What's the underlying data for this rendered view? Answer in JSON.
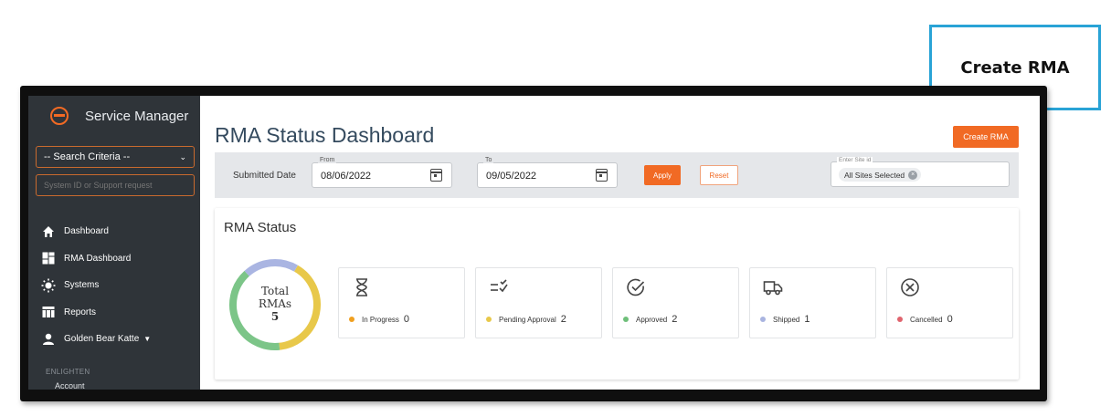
{
  "callout": {
    "text": "Create RMA"
  },
  "sidebar": {
    "brand": "Service Manager",
    "search_criteria": "-- Search Criteria --",
    "search_placeholder": "System ID or Support request",
    "nav": [
      {
        "label": "Dashboard",
        "icon": "home-icon"
      },
      {
        "label": "RMA Dashboard",
        "icon": "grid-icon"
      },
      {
        "label": "Systems",
        "icon": "sun-icon"
      },
      {
        "label": "Reports",
        "icon": "table-icon"
      },
      {
        "label": "Golden Bear Katte",
        "icon": "user-icon"
      }
    ],
    "section_label": "ENLIGHTEN",
    "section_item": "Account"
  },
  "header": {
    "title": "RMA Status Dashboard",
    "create_button": "Create RMA"
  },
  "filters": {
    "submitted_label": "Submitted Date",
    "from_label": "From",
    "from_value": "08/06/2022",
    "to_label": "To",
    "to_value": "09/05/2022",
    "apply": "Apply",
    "reset": "Reset",
    "site_label": "Enter Site id",
    "site_chip": "All Sites Selected"
  },
  "status": {
    "title": "RMA Status",
    "total_line1": "Total",
    "total_line2": "RMAs",
    "total_value": "5",
    "cards": [
      {
        "label": "In Progress",
        "count": "0",
        "color": "#f0a020",
        "icon": "hourglass-icon"
      },
      {
        "label": "Pending Approval",
        "count": "2",
        "color": "#e8c84a",
        "icon": "list-check-icon"
      },
      {
        "label": "Approved",
        "count": "2",
        "color": "#6fbf7a",
        "icon": "check-circle-icon"
      },
      {
        "label": "Shipped",
        "count": "1",
        "color": "#a9b4e0",
        "icon": "truck-icon"
      },
      {
        "label": "Cancelled",
        "count": "0",
        "color": "#e0646e",
        "icon": "x-circle-icon"
      }
    ]
  },
  "chart_data": {
    "type": "pie",
    "categories": [
      "Pending Approval",
      "Approved",
      "Shipped"
    ],
    "values": [
      2,
      2,
      1
    ],
    "colors": [
      "#e8c84a",
      "#7cc588",
      "#aab5e2"
    ]
  }
}
